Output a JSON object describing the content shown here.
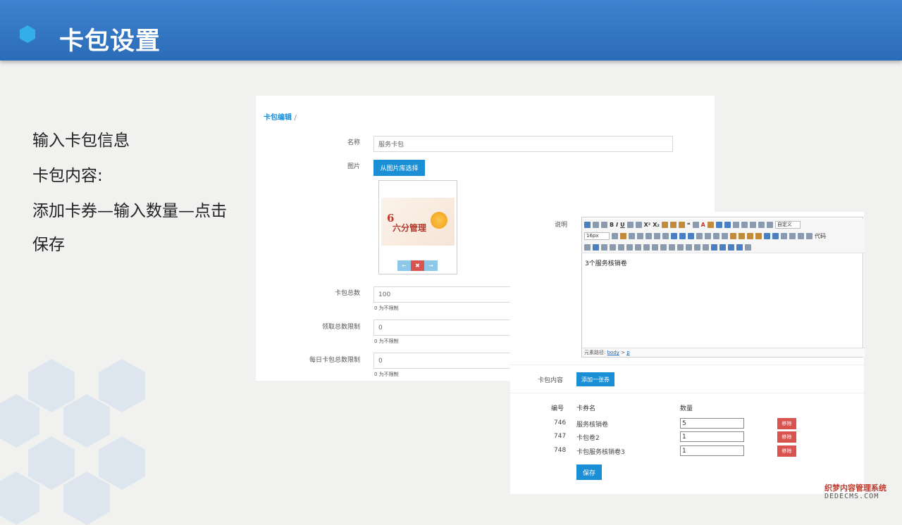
{
  "slide": {
    "title": "卡包设置"
  },
  "steps": [
    "输入卡包信息",
    "卡包内容:",
    "添加卡券—输入数量—点击",
    "保存"
  ],
  "form": {
    "breadcrumb": "卡包编辑",
    "breadcrumb_sep": "/",
    "name_label": "名称",
    "name_value": "服务卡包",
    "image_label": "图片",
    "image_button": "从图片库选择",
    "preview_logo_number": "6",
    "preview_logo_text": "六分管理",
    "preview_controls": [
      "←",
      "✖",
      "→"
    ],
    "total_label": "卡包总数",
    "total_value": "100",
    "total_hint": "0 为不限制",
    "receive_label": "领取总数限制",
    "receive_value": "0",
    "receive_hint": "0 为不限制",
    "daily_label": "每日卡包总数限制",
    "daily_value": "0",
    "daily_hint": "0 为不限制"
  },
  "editor": {
    "label": "说明",
    "font_size": "16px",
    "custom_title": "自定义",
    "code_label": "代码",
    "content": "3个服务核销卷",
    "path_label": "元素路径:",
    "path_body": "body",
    "path_sep": ">",
    "path_p": "p"
  },
  "content_section": {
    "label": "卡包内容",
    "add_button": "添加一张券",
    "columns": {
      "id": "编号",
      "name": "卡券名",
      "qty": "数量"
    },
    "rows": [
      {
        "id": "746",
        "name": "服务核销卷",
        "qty": "5",
        "remove": "移除"
      },
      {
        "id": "747",
        "name": "卡包卷2",
        "qty": "1",
        "remove": "移除"
      },
      {
        "id": "748",
        "name": "卡包服务核销卷3",
        "qty": "1",
        "remove": "移除"
      }
    ],
    "save_button": "保存"
  },
  "watermark": {
    "line1": "织梦内容管理系统",
    "line2": "DEDECMS.COM"
  },
  "colors": {
    "header": "#2f75c4",
    "accent": "#1a8fd6",
    "danger": "#d9534f"
  }
}
